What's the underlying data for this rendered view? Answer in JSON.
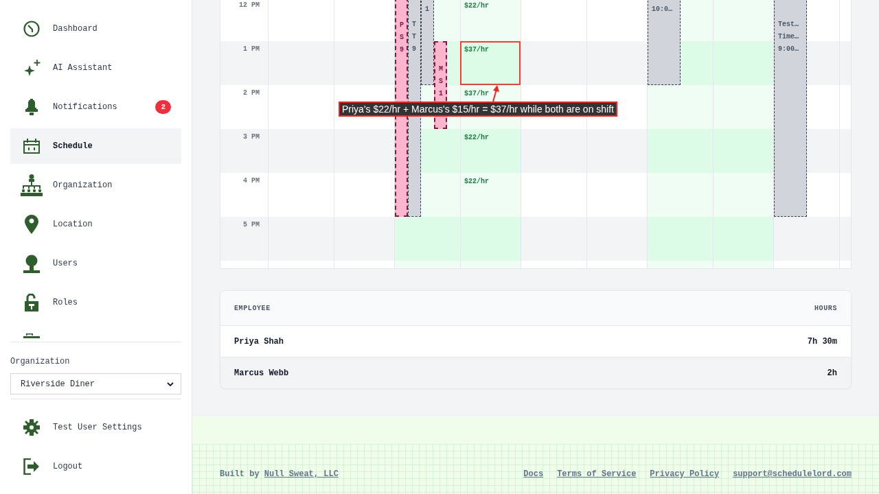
{
  "sidebar": {
    "nav_items": [
      {
        "label": "Dashboard",
        "selected": false
      },
      {
        "label": "AI Assistant",
        "selected": false
      },
      {
        "label": "Notifications",
        "selected": false,
        "badge": "2"
      },
      {
        "label": "Schedule",
        "selected": true
      },
      {
        "label": "Organization",
        "selected": false
      },
      {
        "label": "Location",
        "selected": false
      },
      {
        "label": "Users",
        "selected": false
      },
      {
        "label": "Roles",
        "selected": false
      }
    ],
    "organization": {
      "label": "Organization",
      "value": "Riverside Diner"
    },
    "account_items": [
      "Test User Settings",
      "Logout"
    ]
  },
  "calendar": {
    "time_labels": [
      "12 PM",
      "1 PM",
      "2 PM",
      "3 PM",
      "4 PM",
      "5 PM"
    ],
    "columns": [
      {
        "shaded": false
      },
      {
        "shaded": false
      },
      {
        "shaded": true,
        "shifts": [
          {
            "lines": [
              "P",
              "S",
              "9"
            ],
            "kind": "long",
            "highlighted": true
          },
          {
            "lines": [
              "T",
              "T",
              "9"
            ],
            "kind": "long",
            "highlighted": false
          },
          {
            "lines": [
              "1"
            ],
            "kind": "short",
            "highlighted": false
          },
          {
            "lines": [
              "M",
              "S",
              "1"
            ],
            "kind": "midday",
            "highlighted": true
          }
        ]
      },
      {
        "shaded": true,
        "rates": [
          {
            "text": "$22/hr"
          },
          {
            "text": "$37/hr",
            "note": "Priya's $22/hr + Marcus's $15/hr = $37/hr while both are on shift"
          },
          {
            "text": "$37/hr"
          },
          {
            "text": "$22/hr"
          },
          {
            "text": "$22/hr"
          }
        ]
      },
      {
        "shaded": false
      },
      {
        "shaded": false
      },
      {
        "shaded": true,
        "shifts": [
          {
            "lines": [
              "10:0…"
            ],
            "kind": "short",
            "highlighted": false
          }
        ]
      },
      {
        "shaded": true
      },
      {
        "shaded": false,
        "shifts": [
          {
            "lines": [
              "Test…",
              "Time…",
              "9:00…"
            ],
            "kind": "long",
            "highlighted": false
          }
        ]
      }
    ]
  },
  "summary_table": {
    "columns": [
      "EMPLOYEE",
      "HOURS"
    ],
    "rows": [
      [
        "Priya Shah",
        "7h 30m"
      ],
      [
        "Marcus Webb",
        "2h"
      ]
    ]
  },
  "footer": {
    "credit": "Built by",
    "credit_link": "Null Sweat, LLC",
    "links": [
      "Docs",
      "Terms of Service",
      "Privacy Policy",
      "support@schedulelord.com"
    ]
  }
}
